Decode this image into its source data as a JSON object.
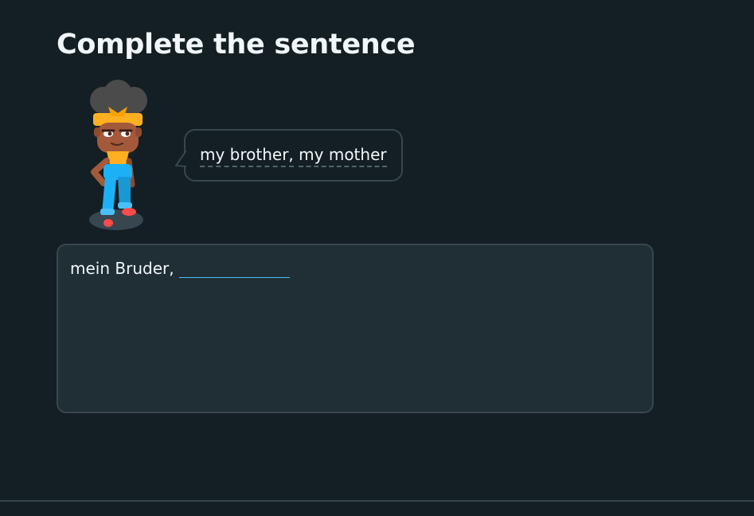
{
  "header": {
    "title": "Complete the sentence"
  },
  "speech_bubble": {
    "word1": "my brother,",
    "word2": "my mother"
  },
  "answer": {
    "prefix": "mein Bruder,",
    "input_value": ""
  },
  "colors": {
    "background": "#131f24",
    "answer_box": "#202f36",
    "border": "#37464f",
    "accent": "#49c0f8",
    "text": "#f1f7fb"
  },
  "icons": {
    "character": "character-avatar-icon"
  }
}
